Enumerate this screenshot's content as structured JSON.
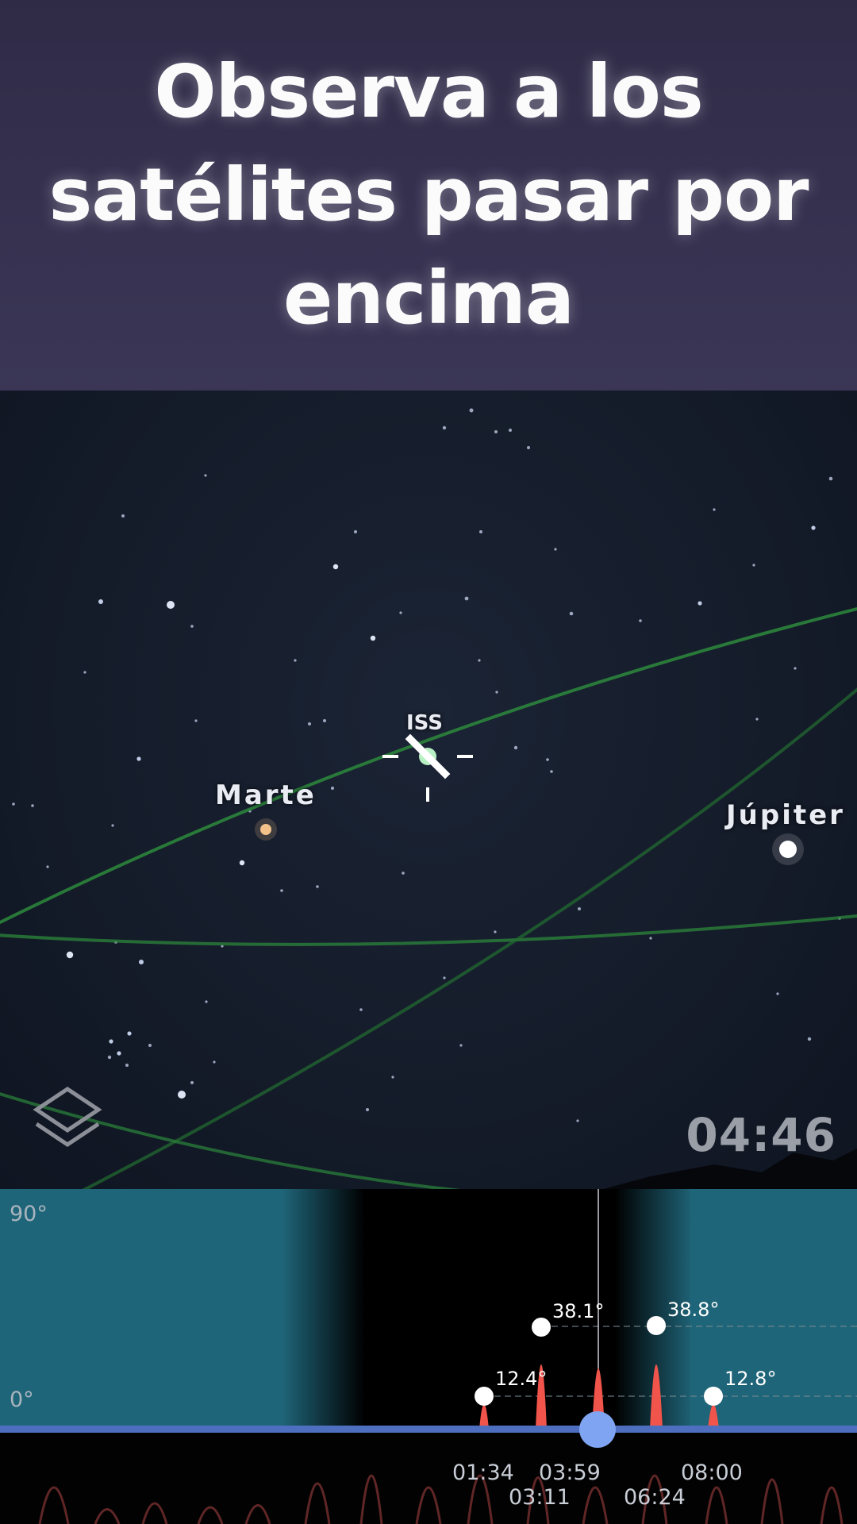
{
  "banner": {
    "title": "Observa a los satélites pasar por encima"
  },
  "sky_map": {
    "satellite_label": "ISS",
    "planets": [
      {
        "name": "Marte",
        "color": "#f0c48a"
      },
      {
        "name": "Júpiter",
        "color": "#ffffff"
      }
    ],
    "current_time": "04:46",
    "layers_icon": "layers-icon",
    "satellite_icon": "satellite-icon",
    "orbit_color": "#2f8a3e"
  },
  "timeline": {
    "altitude_max_label": "90°",
    "altitude_min_label": "0°",
    "passes": [
      {
        "time": "01:34",
        "max_altitude": "12.4°"
      },
      {
        "time": "03:11",
        "max_altitude": "38.1°"
      },
      {
        "time": "03:59",
        "max_altitude": ""
      },
      {
        "time": "06:24",
        "max_altitude": "38.8°"
      },
      {
        "time": "08:00",
        "max_altitude": "12.8°"
      }
    ],
    "day_color": "#1f6579",
    "night_color": "#000000",
    "pass_color": "#f0544a",
    "track_color": "#4e6fbf",
    "handle_color": "#7fa4f2"
  }
}
